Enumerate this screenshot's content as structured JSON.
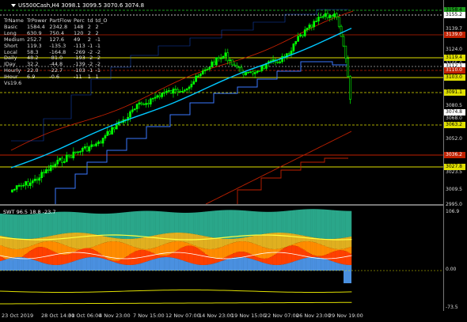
{
  "window": {
    "symbol": "US500Cash,H4",
    "ohlc": "3098.1 3099.5 3070.6 3074.8"
  },
  "stats": {
    "headers": [
      "TrName",
      "TrPower",
      "PartFlow",
      "Perc",
      "td",
      "td_O"
    ],
    "rows": [
      [
        "Basic",
        "1584.4",
        "2342.8",
        "148",
        "2",
        "2"
      ],
      [
        "Long",
        "630.9",
        "750.4",
        "120",
        "2",
        "2"
      ],
      [
        "Medium",
        "252.7",
        "127.6",
        "49",
        "2",
        "-1"
      ],
      [
        "Short",
        "119.3",
        "-135.3",
        "-113",
        "-1",
        "-1"
      ],
      [
        "Local",
        "58.3",
        "-164.8",
        "-269",
        "-2",
        "-2"
      ],
      [
        "Daily",
        "48.2",
        "-81.0",
        "-193",
        "-2",
        "-2"
      ],
      [
        "IDay",
        "32.2",
        "-44.8",
        "-139",
        "-2",
        "-2"
      ],
      [
        "Hourly",
        "22.0",
        "-22.7",
        "-103",
        "-1",
        "-1"
      ],
      [
        "IHour",
        "6.9",
        "-0.6",
        "-11",
        "1",
        "1"
      ]
    ],
    "footer": "Vs19.6"
  },
  "price_axis": {
    "ticks": [
      "3139.7",
      "3124.0",
      "3105.0",
      "3080.5",
      "3068.0",
      "3052.0",
      "3038.5",
      "3023.5",
      "3009.5",
      "2995.0"
    ],
    "labels": [
      {
        "text": "3158.4",
        "bg": "#1a9a1a",
        "fg": "#000"
      },
      {
        "text": "3155.2",
        "bg": "#ffffff",
        "fg": "#000"
      },
      {
        "text": "3139.0",
        "bg": "#c02000",
        "fg": "#fff"
      },
      {
        "text": "3119.4",
        "bg": "#e0e000",
        "fg": "#000"
      },
      {
        "text": "3112.1",
        "bg": "#ffffff",
        "fg": "#000"
      },
      {
        "text": "3110.0",
        "bg": "#c02000",
        "fg": "#fff"
      },
      {
        "text": "3103.0",
        "bg": "#e0e000",
        "fg": "#000"
      },
      {
        "text": "3091.1",
        "bg": "#e0e000",
        "fg": "#000"
      },
      {
        "text": "3074.8",
        "bg": "#ffffff",
        "fg": "#000"
      },
      {
        "text": "3063.2",
        "bg": "#e0e000",
        "fg": "#000"
      },
      {
        "text": "3036.2",
        "bg": "#c02000",
        "fg": "#fff"
      },
      {
        "text": "3027.8",
        "bg": "#e0e000",
        "fg": "#000"
      }
    ]
  },
  "indicator": {
    "title": "SWT 96.5 18.8 -23.7",
    "ticks": [
      "106.9",
      "0.00",
      "-73.5"
    ]
  },
  "time_axis": [
    "23 Oct 2019",
    "28 Oct 14:00",
    "31 Oct 06:00",
    "4 Nov 23:00",
    "7 Nov 15:00",
    "12 Nov 07:00",
    "14 Nov 23:00",
    "19 Nov 15:00",
    "22 Nov 07:00",
    "26 Nov 23:00",
    "29 Nov 19:00"
  ],
  "colors": {
    "bull": "#00ff00",
    "bear": "#00ff00",
    "ma_cyan": "#00c8ff",
    "trail_blue": "#3a78ff",
    "channel_red": "#c02000",
    "level_yellow": "#e0e000",
    "hist_red": "#ff4000",
    "hist_orange": "#ff8c00",
    "hist_blue": "#4a90e0",
    "hist_teal": "#2aa78a"
  }
}
